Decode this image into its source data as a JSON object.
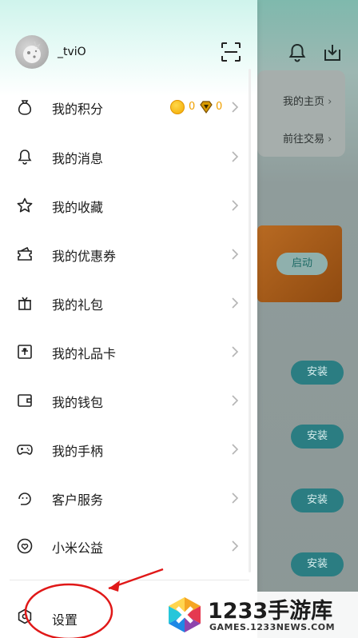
{
  "background_app": {
    "links": [
      "我的主页",
      "前往交易"
    ],
    "launch_label": "启动",
    "install_labels": [
      "安装",
      "安装",
      "安装",
      "安装"
    ]
  },
  "drawer": {
    "username": "_tviO",
    "points": {
      "coins": "0",
      "gems": "0"
    },
    "menu": [
      {
        "label": "我的积分",
        "icon": "points-bag-icon"
      },
      {
        "label": "我的消息",
        "icon": "bell-icon"
      },
      {
        "label": "我的收藏",
        "icon": "star-icon"
      },
      {
        "label": "我的优惠券",
        "icon": "coupon-icon"
      },
      {
        "label": "我的礼包",
        "icon": "gift-icon"
      },
      {
        "label": "我的礼品卡",
        "icon": "gift-card-icon"
      },
      {
        "label": "我的钱包",
        "icon": "wallet-icon"
      },
      {
        "label": "我的手柄",
        "icon": "gamepad-icon"
      },
      {
        "label": "客户服务",
        "icon": "customer-service-icon"
      },
      {
        "label": "小米公益",
        "icon": "heart-icon"
      }
    ],
    "settings_label": "设置"
  },
  "watermark": {
    "title": "1233手游库",
    "subtitle": "GAMES.1233NEWS.COM"
  },
  "colors": {
    "accent_teal": "#2b7d82",
    "annotation_red": "#e01818",
    "coin_gold": "#f2a900"
  }
}
